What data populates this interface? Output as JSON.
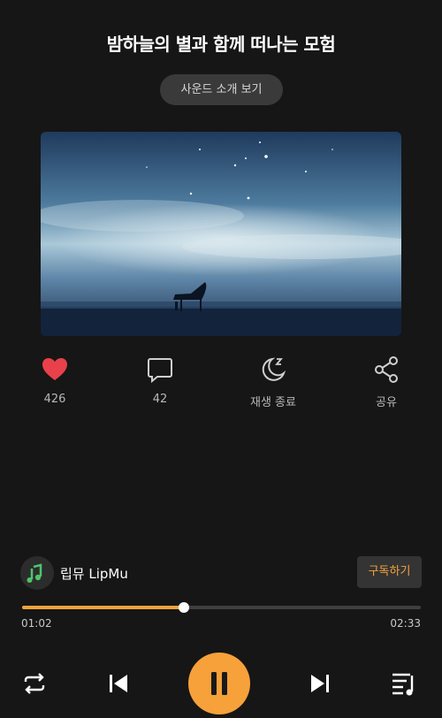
{
  "title": "밤하늘의 별과 함께 떠나는 모험",
  "intro_button": "사운드 소개 보기",
  "artwork": {
    "description_icon": "piano-night-sky-image"
  },
  "actions": {
    "like": {
      "icon": "heart-icon",
      "count": "426",
      "color": "#e8414b"
    },
    "comment": {
      "icon": "comment-icon",
      "count": "42"
    },
    "sleep": {
      "icon": "moon-sleep-icon",
      "label": "재생 종료"
    },
    "share": {
      "icon": "share-icon",
      "label": "공유"
    }
  },
  "artist": {
    "name": "립뮤 LipMu",
    "avatar_icon": "music-note-logo",
    "subscribe_label": "구독하기"
  },
  "player": {
    "progress_fraction": 0.405,
    "current_time": "01:02",
    "total_time": "02:33",
    "accent_color": "#f6a33b"
  },
  "controls": {
    "repeat_icon": "repeat-icon",
    "prev_icon": "skip-previous-icon",
    "play_state": "pause-icon",
    "next_icon": "skip-next-icon",
    "playlist_icon": "playlist-icon"
  }
}
